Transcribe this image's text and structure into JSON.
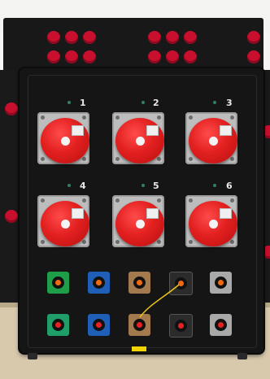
{
  "photo": {
    "panel_color": "#151515",
    "cee_color": "#e32020",
    "floor_color": "#d8c9ad"
  },
  "socket_numbers": [
    "1",
    "2",
    "3",
    "4",
    "5",
    "6"
  ],
  "small_sockets_top": [
    "green",
    "blue",
    "bronze",
    "black",
    "silver"
  ],
  "small_sockets_bottom": [
    "green",
    "blue",
    "bronze",
    "black",
    "silver"
  ]
}
